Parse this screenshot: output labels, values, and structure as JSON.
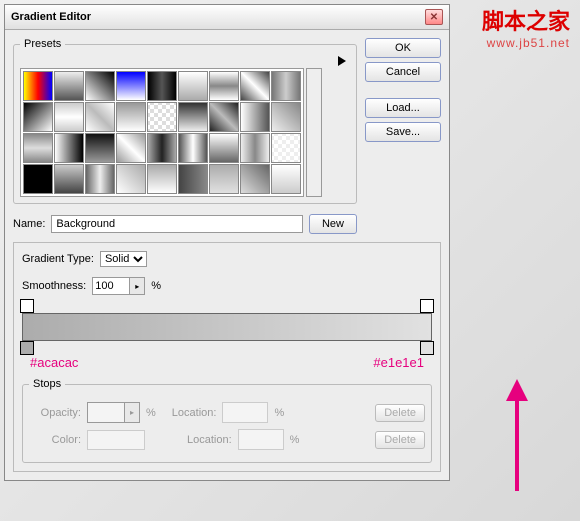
{
  "watermark": {
    "title": "脚本之家",
    "url": "www.jb51.net"
  },
  "dialog": {
    "title": "Gradient Editor"
  },
  "buttons": {
    "ok": "OK",
    "cancel": "Cancel",
    "load": "Load...",
    "save": "Save...",
    "new": "New",
    "delete": "Delete"
  },
  "presets": {
    "legend": "Presets"
  },
  "name": {
    "label": "Name:",
    "value": "Background"
  },
  "gradType": {
    "label": "Gradient Type:",
    "value": "Solid"
  },
  "smoothness": {
    "label": "Smoothness:",
    "value": "100",
    "unit": "%"
  },
  "hex": {
    "left": "#acacac",
    "right": "#e1e1e1"
  },
  "stops": {
    "legend": "Stops",
    "opacity": "Opacity:",
    "color": "Color:",
    "location": "Location:",
    "pct": "%"
  },
  "swatches": [
    "linear-gradient(90deg,#ff0,#f00,#00f)",
    "linear-gradient(#eee,#555)",
    "linear-gradient(45deg,#fff,#000)",
    "linear-gradient(#00f,#fff)",
    "linear-gradient(90deg,#000,#555,#000)",
    "linear-gradient(#fff,#aaa)",
    "linear-gradient(#fff,#888,#fff)",
    "linear-gradient(45deg,#444,#fff,#444)",
    "linear-gradient(90deg,#777,#ccc,#777)",
    "linear-gradient(135deg,#000,#fff)",
    "linear-gradient(#ccc,#fff,#ccc)",
    "linear-gradient(45deg,#fff,#bbb,#fff)",
    "linear-gradient(#999,#fff)",
    "repeating-conic-gradient(#ddd 0 25%,#fff 0 50%) 50%/8px 8px",
    "linear-gradient(#333,#eee)",
    "linear-gradient(45deg,#222,#bbb,#222)",
    "linear-gradient(90deg,#fff,#555)",
    "linear-gradient(45deg,#eee,#888)",
    "linear-gradient(#888,#ddd,#888)",
    "linear-gradient(90deg,#fff,#000)",
    "linear-gradient(#111,#999)",
    "linear-gradient(45deg,#999,#fff,#999)",
    "linear-gradient(90deg,#aaa,#222,#aaa)",
    "linear-gradient(90deg,#555,#fff,#555)",
    "linear-gradient(#fff,#666)",
    "linear-gradient(90deg,#eee,#888,#eee)",
    "repeating-conic-gradient(#eee 0 25%,#fff 0 50%) 50%/8px 8px",
    "linear-gradient(135deg,#000,#000)",
    "linear-gradient(#ccc,#444)",
    "linear-gradient(90deg,#666,#eee,#666)",
    "linear-gradient(45deg,#fff,#aaa)",
    "linear-gradient(#aaa,#fff)",
    "linear-gradient(90deg,#444,#888)",
    "linear-gradient(#acacac,#e1e1e1)",
    "linear-gradient(45deg,#ddd,#666)",
    "linear-gradient(#fff,#ccc)"
  ]
}
